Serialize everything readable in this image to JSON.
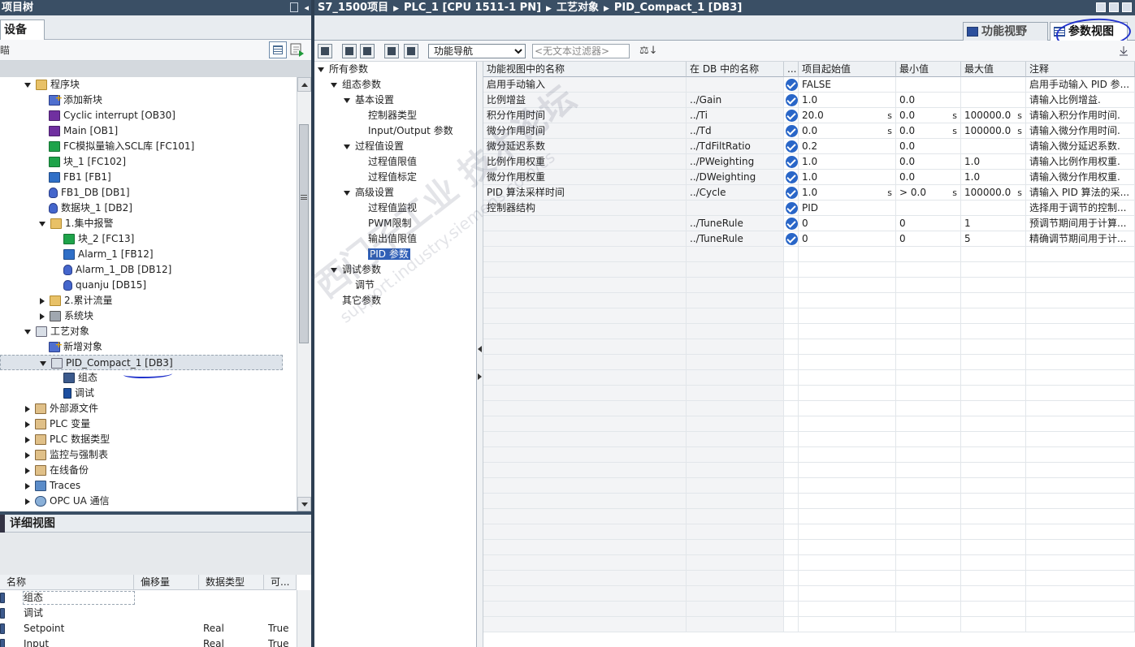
{
  "left_title": "项目树",
  "device_tab": "设备",
  "toolbar_fragment": "瞄",
  "tree": [
    {
      "label": "程序块",
      "icon": "folder-block-icon",
      "expand": "down",
      "level": 1
    },
    {
      "label": "添加新块",
      "icon": "add-block-icon",
      "expand": "",
      "level": 2
    },
    {
      "label": "Cyclic interrupt [OB30]",
      "icon": "ob-block-icon",
      "expand": "",
      "level": 2
    },
    {
      "label": "Main [OB1]",
      "icon": "ob-block-icon",
      "expand": "",
      "level": 2
    },
    {
      "label": "FC模拟量输入SCL库 [FC101]",
      "icon": "fc-block-icon",
      "expand": "",
      "level": 2
    },
    {
      "label": "块_1 [FC102]",
      "icon": "fc-block-icon",
      "expand": "",
      "level": 2
    },
    {
      "label": "FB1 [FB1]",
      "icon": "fb-block-icon",
      "expand": "",
      "level": 2
    },
    {
      "label": "FB1_DB [DB1]",
      "icon": "db-block-icon",
      "expand": "",
      "level": 2
    },
    {
      "label": "数据块_1 [DB2]",
      "icon": "db-block-icon",
      "expand": "",
      "level": 2
    },
    {
      "label": "1.集中报警",
      "icon": "folder-icon",
      "expand": "down",
      "level": 2
    },
    {
      "label": "块_2 [FC13]",
      "icon": "fc-block-icon",
      "expand": "",
      "level": 3
    },
    {
      "label": "Alarm_1 [FB12]",
      "icon": "fb-block-icon",
      "expand": "",
      "level": 3
    },
    {
      "label": "Alarm_1_DB [DB12]",
      "icon": "db-block-icon",
      "expand": "",
      "level": 3
    },
    {
      "label": "quanju [DB15]",
      "icon": "db-block-icon",
      "expand": "",
      "level": 3
    },
    {
      "label": "2.累计流量",
      "icon": "folder-icon",
      "expand": "right",
      "level": 2
    },
    {
      "label": "系统块",
      "icon": "system-block-icon",
      "expand": "right",
      "level": 2
    },
    {
      "label": "工艺对象",
      "icon": "tech-object-icon",
      "expand": "down",
      "level": 1
    },
    {
      "label": "新增对象",
      "icon": "add-object-icon",
      "expand": "",
      "level": 2
    },
    {
      "label": "PID_Compact_1 [DB3]",
      "icon": "pid-object-icon",
      "expand": "down",
      "level": 2,
      "selected": true
    },
    {
      "label": "组态",
      "icon": "configuration-icon",
      "expand": "",
      "level": 3
    },
    {
      "label": "调试",
      "icon": "commissioning-icon",
      "expand": "",
      "level": 3
    },
    {
      "label": "外部源文件",
      "icon": "external-source-icon",
      "expand": "right",
      "level": 1
    },
    {
      "label": "PLC 变量",
      "icon": "plc-tags-icon",
      "expand": "right",
      "level": 1
    },
    {
      "label": "PLC 数据类型",
      "icon": "plc-datatypes-icon",
      "expand": "right",
      "level": 1
    },
    {
      "label": "监控与强制表",
      "icon": "watch-table-icon",
      "expand": "right",
      "level": 1
    },
    {
      "label": "在线备份",
      "icon": "online-backup-icon",
      "expand": "right",
      "level": 1
    },
    {
      "label": "Traces",
      "icon": "traces-icon",
      "expand": "right",
      "level": 1
    },
    {
      "label": "OPC UA 通信",
      "icon": "opcua-icon",
      "expand": "right",
      "level": 1
    }
  ],
  "detail": {
    "title": "详细视图",
    "headers": [
      "名称",
      "偏移量",
      "数据类型",
      "可..."
    ],
    "rows": [
      {
        "name": "组态",
        "offset": "",
        "type": "",
        "access": ""
      },
      {
        "name": "调试",
        "offset": "",
        "type": "",
        "access": ""
      },
      {
        "name": "Setpoint",
        "offset": "",
        "type": "Real",
        "access": "True"
      },
      {
        "name": "Input",
        "offset": "",
        "type": "Real",
        "access": "True"
      }
    ]
  },
  "breadcrumb": [
    "S7_1500项目",
    "PLC_1 [CPU 1511-1 PN]",
    "工艺对象",
    "PID_Compact_1 [DB3]"
  ],
  "view_tabs": {
    "function": "功能视野",
    "param": "参数视图"
  },
  "right_toolbar": {
    "nav_select": "功能导航",
    "filter_placeholder": "<无文本过滤器>"
  },
  "nav": [
    {
      "label": "所有参数",
      "expand": "down",
      "level": 0
    },
    {
      "label": "组态参数",
      "expand": "down",
      "level": 1
    },
    {
      "label": "基本设置",
      "expand": "down",
      "level": 2
    },
    {
      "label": "控制器类型",
      "expand": "",
      "level": 3
    },
    {
      "label": "Input/Output 参数",
      "expand": "",
      "level": 3
    },
    {
      "label": "过程值设置",
      "expand": "down",
      "level": 2
    },
    {
      "label": "过程值限值",
      "expand": "",
      "level": 3
    },
    {
      "label": "过程值标定",
      "expand": "",
      "level": 3
    },
    {
      "label": "高级设置",
      "expand": "down",
      "level": 2
    },
    {
      "label": "过程值监视",
      "expand": "",
      "level": 3
    },
    {
      "label": "PWM限制",
      "expand": "",
      "level": 3
    },
    {
      "label": "输出值限值",
      "expand": "",
      "level": 3
    },
    {
      "label": "PID 参数",
      "expand": "",
      "level": 3,
      "selected": true
    },
    {
      "label": "调试参数",
      "expand": "down",
      "level": 1
    },
    {
      "label": "调节",
      "expand": "",
      "level": 2
    },
    {
      "label": "其它参数",
      "expand": "",
      "level": 1
    }
  ],
  "grid": {
    "headers": [
      "功能视图中的名称",
      "在 DB 中的名称",
      "...",
      "项目起始值",
      "最小值",
      "最大值",
      "注释"
    ],
    "rows": [
      {
        "name": "启用手动输入",
        "db": "",
        "check": true,
        "start": "FALSE",
        "su": "",
        "min": "",
        "mu": "",
        "max": "",
        "xu": "",
        "comment": "启用手动输入 PID 参..."
      },
      {
        "name": "比例增益",
        "db": "../Gain",
        "check": true,
        "start": "1.0",
        "su": "",
        "min": "0.0",
        "mu": "",
        "max": "",
        "xu": "",
        "comment": "请输入比例增益."
      },
      {
        "name": "积分作用时间",
        "db": "../Ti",
        "check": true,
        "start": "20.0",
        "su": "s",
        "min": "0.0",
        "mu": "s",
        "max": "100000.0",
        "xu": "s",
        "comment": "请输入积分作用时间."
      },
      {
        "name": "微分作用时间",
        "db": "../Td",
        "check": true,
        "start": "0.0",
        "su": "s",
        "min": "0.0",
        "mu": "s",
        "max": "100000.0",
        "xu": "s",
        "comment": "请输入微分作用时间."
      },
      {
        "name": "微分延迟系数",
        "db": "../TdFiltRatio",
        "check": true,
        "start": "0.2",
        "su": "",
        "min": "0.0",
        "mu": "",
        "max": "",
        "xu": "",
        "comment": "请输入微分延迟系数."
      },
      {
        "name": "比例作用权重",
        "db": "../PWeighting",
        "check": true,
        "start": "1.0",
        "su": "",
        "min": "0.0",
        "mu": "",
        "max": "1.0",
        "xu": "",
        "comment": "请输入比例作用权重."
      },
      {
        "name": "微分作用权重",
        "db": "../DWeighting",
        "check": true,
        "start": "1.0",
        "su": "",
        "min": "0.0",
        "mu": "",
        "max": "1.0",
        "xu": "",
        "comment": "请输入微分作用权重."
      },
      {
        "name": "PID 算法采样时间",
        "db": "../Cycle",
        "check": true,
        "start": "1.0",
        "su": "s",
        "min": "> 0.0",
        "mu": "s",
        "max": "100000.0",
        "xu": "s",
        "comment": "请输入 PID 算法的采..."
      },
      {
        "name": "控制器结构",
        "db": "",
        "check": true,
        "start": "PID",
        "su": "",
        "min": "",
        "mu": "",
        "max": "",
        "xu": "",
        "comment": "选择用于调节的控制..."
      },
      {
        "name": "",
        "db": "../TuneRule",
        "check": true,
        "start": "0",
        "su": "",
        "min": "0",
        "mu": "",
        "max": "1",
        "xu": "",
        "comment": "预调节期间用于计算..."
      },
      {
        "name": "",
        "db": "../TuneRule",
        "check": true,
        "start": "0",
        "su": "",
        "min": "0",
        "mu": "",
        "max": "5",
        "xu": "",
        "comment": "精确调节期间用于计..."
      }
    ]
  },
  "watermark": {
    "line1": "西门子工业 技术论坛",
    "line2": "support.industry.siemens.com/cs"
  }
}
